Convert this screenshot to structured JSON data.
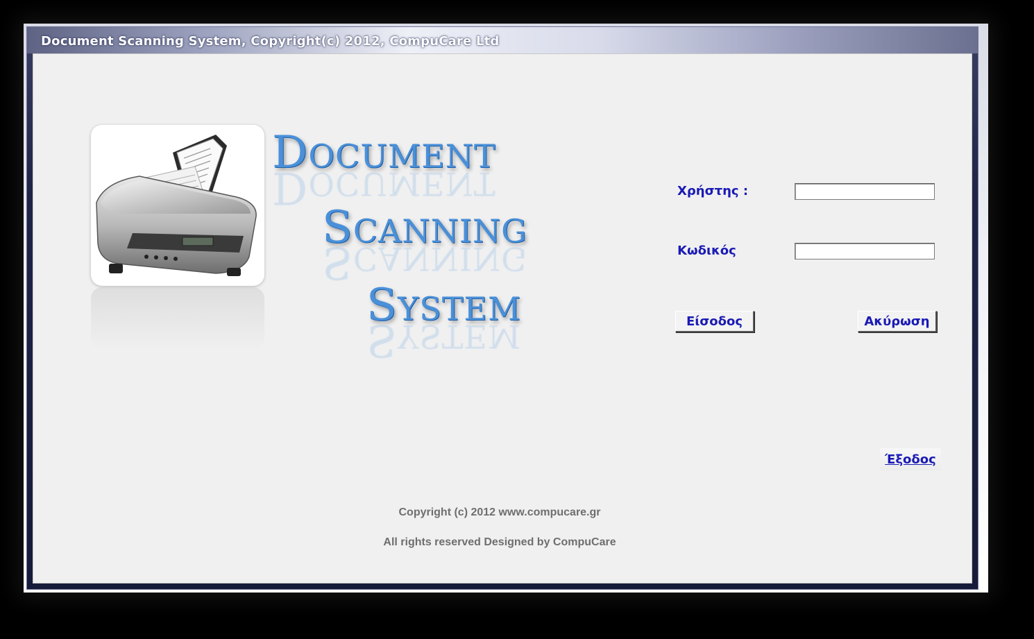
{
  "window": {
    "title": "Document Scanning System, Copyright(c) 2012, CompuCare Ltd"
  },
  "logo": {
    "words": [
      {
        "cap": "D",
        "rest": "OCUMENT"
      },
      {
        "cap": "S",
        "rest": "CANNING"
      },
      {
        "cap": "S",
        "rest": "YSTEM"
      }
    ]
  },
  "login": {
    "user_label": "Χρήστης :",
    "user_value": "",
    "password_label": "Κωδικός",
    "password_value": "",
    "login_button": "Είσοδος",
    "cancel_button": "Ακύρωση",
    "exit_link": "Έξοδος"
  },
  "footer": {
    "copyright": "Copyright (c) 2012 www.compucare.gr",
    "rights": "All rights reserved Designed by CompuCare"
  },
  "colors": {
    "label_blue": "#1a1ab5",
    "logo_blue": "#4a90d9"
  }
}
